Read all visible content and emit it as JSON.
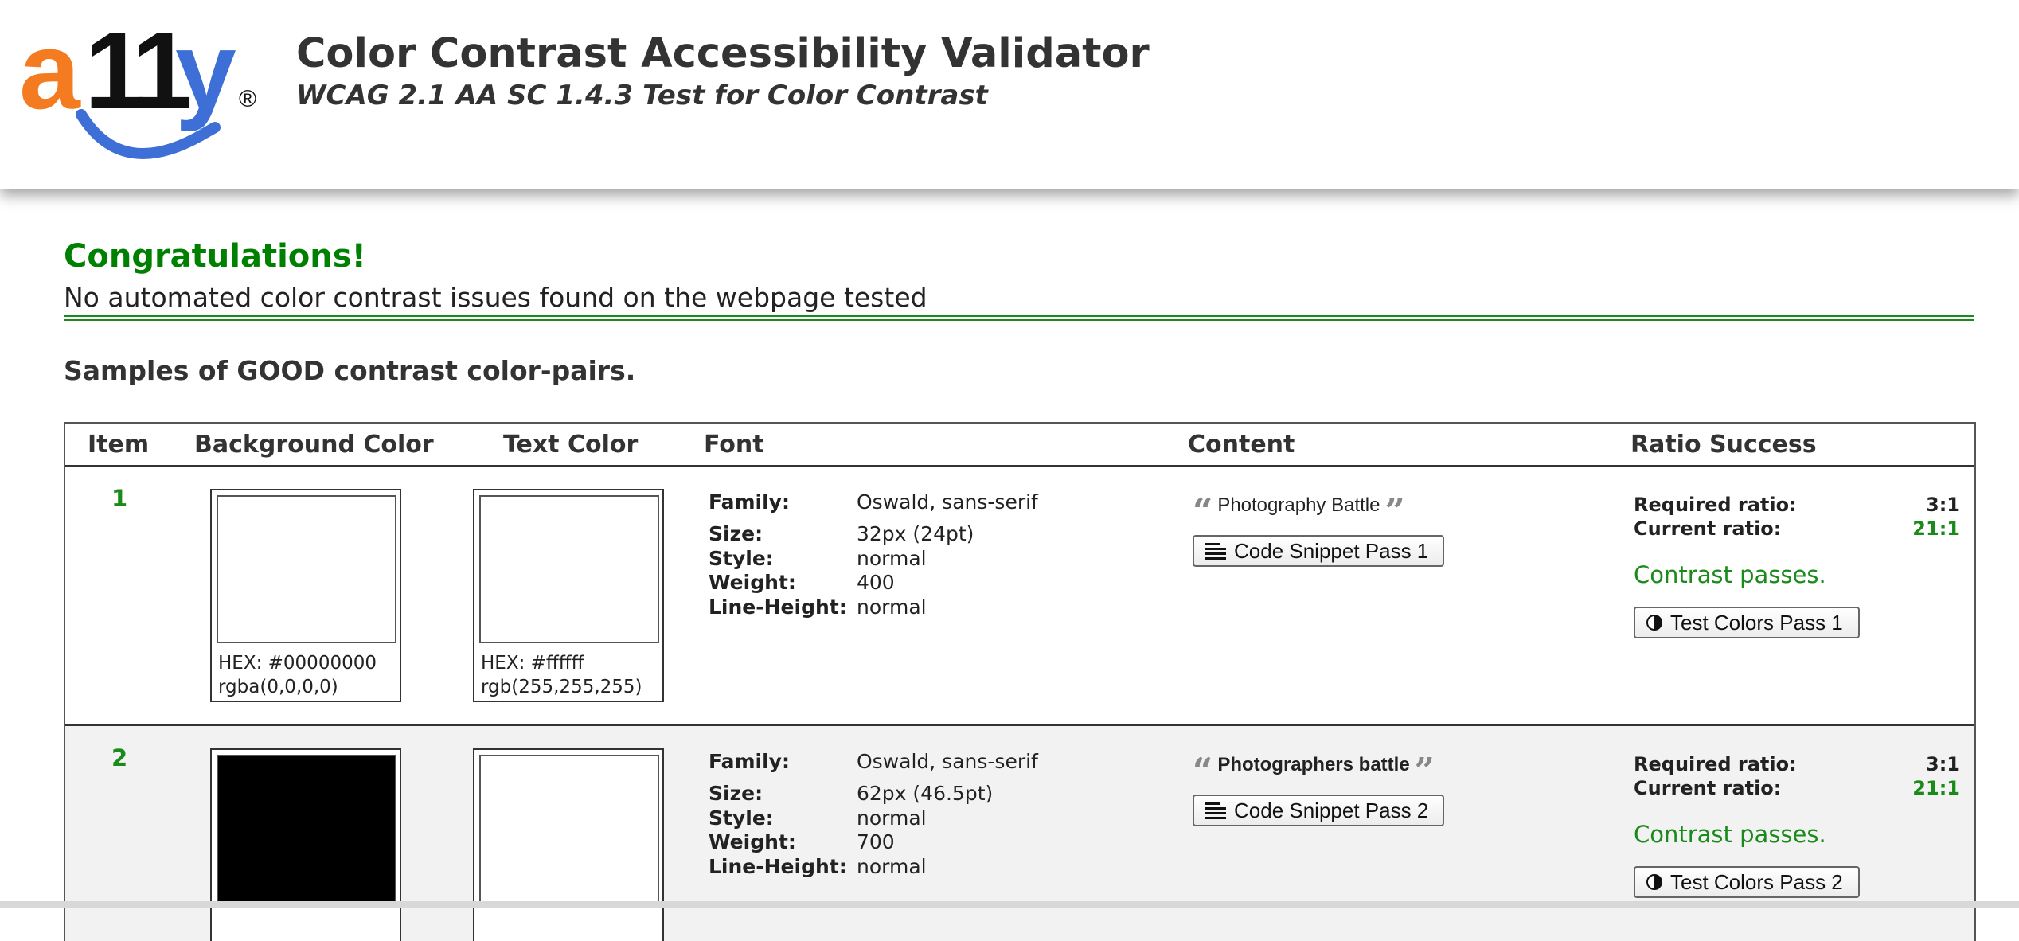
{
  "header": {
    "logo": {
      "a": "a",
      "eleven": "11",
      "y": "y",
      "registered": "®"
    },
    "title": "Color Contrast Accessibility Validator",
    "subtitle": "WCAG 2.1 AA SC 1.4.3 Test for Color Contrast"
  },
  "result": {
    "heading": "Congratulations!",
    "message": "No automated color contrast issues found on the webpage tested"
  },
  "samples_heading": "Samples of GOOD contrast color-pairs.",
  "table": {
    "columns": [
      "Item",
      "Background Color",
      "Text Color",
      "Font",
      "Content",
      "Ratio Success"
    ],
    "font_labels": {
      "family": "Family:",
      "size": "Size:",
      "style": "Style:",
      "weight": "Weight:",
      "line_height": "Line-Height:"
    },
    "ratio_labels": {
      "required": "Required ratio:",
      "current": "Current ratio:"
    },
    "rows": [
      {
        "item": "1",
        "background": {
          "hex": "HEX: #00000000",
          "rgb": "rgba(0,0,0,0)",
          "swatch": "#ffffff"
        },
        "text": {
          "hex": "HEX: #ffffff",
          "rgb": "rgb(255,255,255)",
          "swatch": "#ffffff"
        },
        "font": {
          "family": "Oswald, sans-serif",
          "size": "32px (24pt)",
          "style": "normal",
          "weight": "400",
          "line_height": "normal"
        },
        "content": "Photography Battle",
        "snippet_button": "Code Snippet Pass 1",
        "required_ratio": "3:1",
        "current_ratio": "21:1",
        "status": "Contrast passes.",
        "test_button": "Test Colors Pass 1"
      },
      {
        "item": "2",
        "background": {
          "swatch": "#000000"
        },
        "text": {
          "swatch": "#ffffff"
        },
        "font": {
          "family": "Oswald, sans-serif",
          "size": "62px (46.5pt)",
          "style": "normal",
          "weight": "700",
          "line_height": "normal"
        },
        "content": "Photographers battle",
        "snippet_button": "Code Snippet Pass 2",
        "required_ratio": "3:1",
        "current_ratio": "21:1",
        "status": "Contrast passes.",
        "test_button": "Test Colors Pass 2"
      }
    ]
  },
  "colors": {
    "success_green": "#1a8a1a",
    "heading_green": "#008000",
    "logo_orange": "#f57b20",
    "logo_blue": "#3d6fd6",
    "row_alt_bg": "#f2f2f2"
  },
  "icons": {
    "open_quote": "“",
    "close_quote": "”",
    "snippet_icon": "align-left-icon",
    "test_icon": "contrast-icon"
  }
}
